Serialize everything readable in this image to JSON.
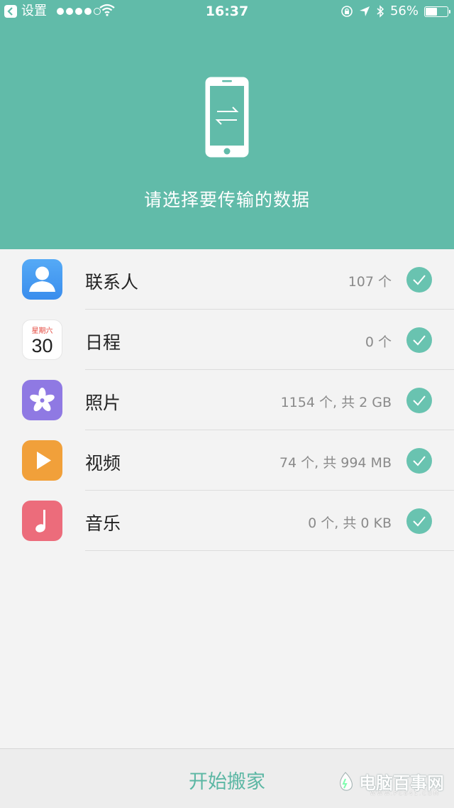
{
  "status_bar": {
    "back_label": "设置",
    "signal_dots": 5,
    "time": "16:37",
    "battery": "56%",
    "battery_level": 0.56
  },
  "header": {
    "title": "请选择要传输的数据"
  },
  "items": [
    {
      "label": "联系人",
      "count": "107 个",
      "icon": "contacts-icon",
      "color": "#4d9ff2",
      "checked": true
    },
    {
      "label": "日程",
      "count": "0 个",
      "icon": "calendar-icon",
      "color": "#ffffff",
      "calendar_weekday": "星期六",
      "calendar_day": "30",
      "checked": true
    },
    {
      "label": "照片",
      "count": "1154 个, 共 2 GB",
      "icon": "photos-icon",
      "color": "#8f79e3",
      "checked": true
    },
    {
      "label": "视频",
      "count": "74 个, 共 994 MB",
      "icon": "video-icon",
      "color": "#f1a03a",
      "checked": true
    },
    {
      "label": "音乐",
      "count": "0 个, 共 0 KB",
      "icon": "music-icon",
      "color": "#ec6c7b",
      "checked": true
    }
  ],
  "footer": {
    "start_label": "开始搬家"
  },
  "watermark": {
    "text": "电脑百事网",
    "url": "WWW.PC841.COM"
  },
  "colors": {
    "accent": "#61bba9",
    "check": "#69c3b0",
    "background": "#f3f3f3"
  }
}
